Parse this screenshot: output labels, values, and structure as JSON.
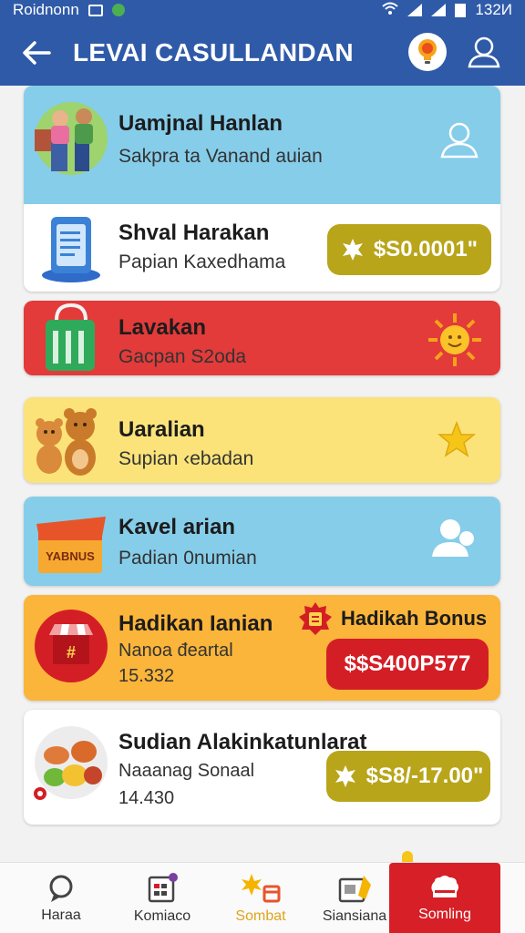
{
  "status_bar": {
    "carrier": "Roidnonn",
    "time": "132И"
  },
  "app_bar": {
    "title": "LEVAI CASULLANDAN"
  },
  "cards": [
    {
      "title": "Uamjnal Hanlan",
      "subtitle": "Sakpra ta Vanand auian",
      "icon": "family-illustration",
      "trailing_icon": "user-outline-icon"
    },
    {
      "title": "Shval Harakan",
      "subtitle": "Papian Kaxedhama",
      "icon": "clipboard-illustration",
      "price": "$S0.0001\"",
      "price_icon": "gear-badge-icon"
    },
    {
      "title": "Lavakan",
      "subtitle": "Gacpan S2oda",
      "icon": "shopping-bag-illustration",
      "trailing_icon": "sun-icon"
    },
    {
      "title": "Uaralian",
      "subtitle": "Supian ‹ebadan",
      "icon": "bears-illustration",
      "trailing_icon": "star-icon"
    },
    {
      "title": "Kavel arian",
      "subtitle": "Padian 0numian",
      "icon": "bonus-box-illustration",
      "box_label": "YABNUS",
      "trailing_icon": "user-add-icon"
    },
    {
      "title": "Hadikan Ianian",
      "subtitle": "Nanoa đeartal",
      "detail": "15.332",
      "icon": "shop-illustration",
      "badge_label": "Hadikah Bonus",
      "price": "$$S400P577",
      "price_icon": "receipt-badge-icon"
    },
    {
      "title": "Sudian Alakinkatunlarat",
      "subtitle": "Naaanag Sonaal",
      "detail": "14.430",
      "icon": "vegetables-illustration",
      "price": "$S8/-17.00\"",
      "price_icon": "gear-badge-icon"
    }
  ],
  "bottom_nav": [
    {
      "label": "Haraa",
      "icon": "search-icon"
    },
    {
      "label": "Komiaco",
      "icon": "calendar-icon"
    },
    {
      "label": "Sombat",
      "icon": "gift-icon"
    },
    {
      "label": "Siansiana",
      "icon": "wallet-icon"
    },
    {
      "label": "Somling",
      "icon": "chat-icon"
    }
  ],
  "colors": {
    "primary": "#2f5aa8",
    "sky": "#86cdea",
    "red": "#e23b3a",
    "yellow": "#fbe37a",
    "orange": "#fbb53a",
    "olive": "#b8a51a",
    "accent_red": "#d41e26"
  }
}
